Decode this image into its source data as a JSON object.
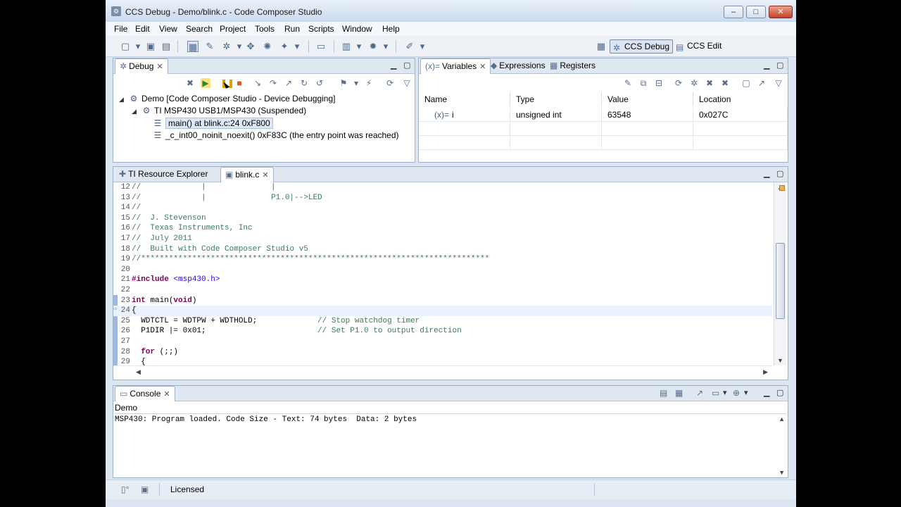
{
  "window": {
    "title": "CCS Debug - Demo/blink.c - Code Composer Studio",
    "controls": [
      "–",
      "□",
      "✕"
    ]
  },
  "menu": [
    "File",
    "Edit",
    "View",
    "Search",
    "Project",
    "Tools",
    "Run",
    "Scripts",
    "Window",
    "Help"
  ],
  "perspectives": {
    "debug": "CCS Debug",
    "edit": "CCS Edit"
  },
  "debug_view": {
    "tab": "Debug",
    "tree": [
      {
        "label": "Demo [Code Composer Studio - Device Debugging]",
        "icon": "project-icon",
        "level": 0
      },
      {
        "label": "TI MSP430 USB1/MSP430 (Suspended)",
        "icon": "cpu-icon",
        "level": 1
      },
      {
        "label": "main() at blink.c:24 0xF800",
        "icon": "stack-frame-icon",
        "level": 2,
        "selected": true
      },
      {
        "label": "_c_int00_noinit_noexit() 0xF83C  (the entry point was reached)",
        "icon": "stack-frame-icon",
        "level": 2
      }
    ]
  },
  "variables_view": {
    "tabs": [
      "Variables",
      "Expressions",
      "Registers"
    ],
    "columns": [
      "Name",
      "Type",
      "Value",
      "Location"
    ],
    "rows": [
      {
        "name": "i",
        "type": "unsigned int",
        "value": "63548",
        "location": "0x027C"
      }
    ]
  },
  "editor": {
    "tabs": [
      "TI Resource Explorer",
      "blink.c"
    ],
    "lines": [
      {
        "n": "12",
        "text": "//             |              |"
      },
      {
        "n": "13",
        "text": "//             |              P1.0|-->LED"
      },
      {
        "n": "14",
        "text": "//"
      },
      {
        "n": "15",
        "text": "//  J. Stevenson"
      },
      {
        "n": "16",
        "text": "//  Texas Instruments, Inc"
      },
      {
        "n": "17",
        "text": "//  July 2011"
      },
      {
        "n": "18",
        "text": "//  Built with Code Composer Studio v5"
      },
      {
        "n": "19",
        "text": "//***************************************************************************"
      },
      {
        "n": "20",
        "text": ""
      },
      {
        "n": "21",
        "text": "#include <msp430.h>"
      },
      {
        "n": "22",
        "text": ""
      },
      {
        "n": "23",
        "text": "int main(void)"
      },
      {
        "n": "24",
        "text": "{"
      },
      {
        "n": "25",
        "text": "  WDTCTL = WDTPW + WDTHOLD;             // Stop watchdog timer"
      },
      {
        "n": "26",
        "text": "  P1DIR |= 0x01;                        // Set P1.0 to output direction"
      },
      {
        "n": "27",
        "text": ""
      },
      {
        "n": "28",
        "text": "  for (;;)"
      },
      {
        "n": "29",
        "text": "  {"
      }
    ]
  },
  "console": {
    "tab": "Console",
    "context": "Demo",
    "output": "MSP430: Program loaded. Code Size - Text: 74 bytes  Data: 2 bytes"
  },
  "status": {
    "license": "Licensed"
  }
}
